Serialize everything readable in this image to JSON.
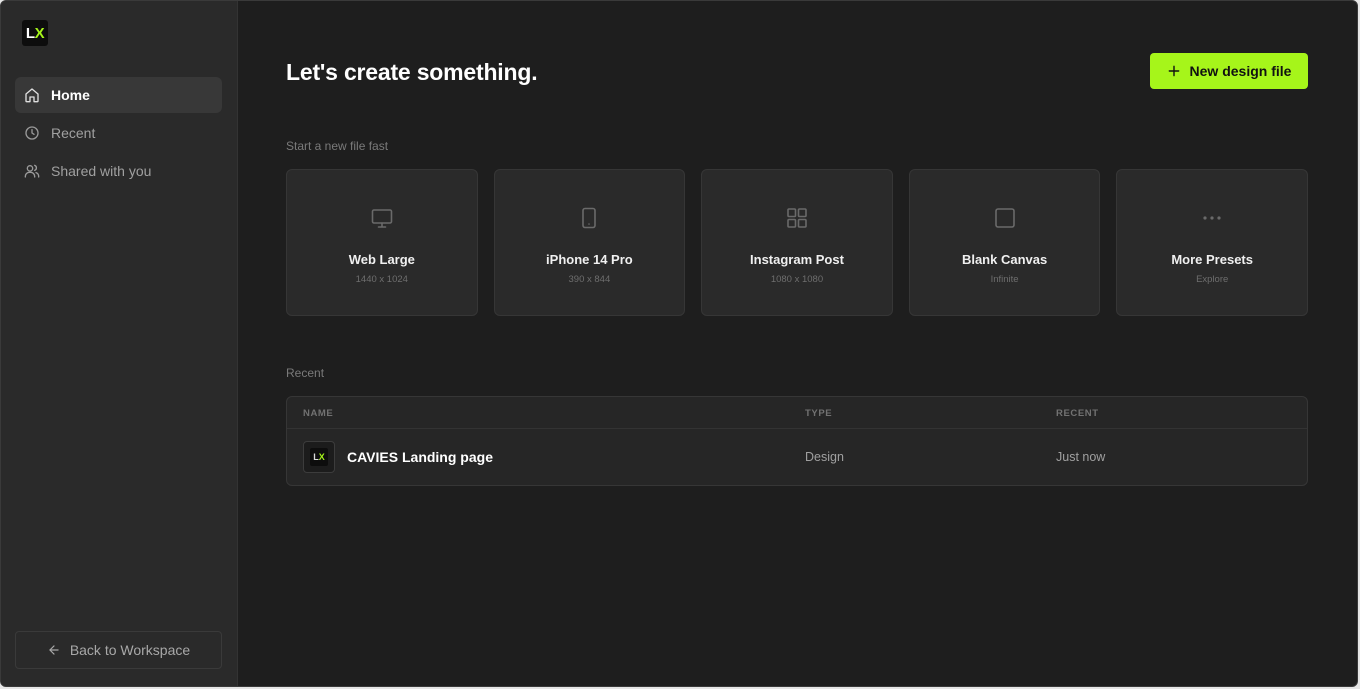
{
  "sidebar": {
    "logo": {
      "l": "L",
      "x": "X"
    },
    "items": [
      {
        "label": "Home",
        "icon": "home-icon",
        "active": true
      },
      {
        "label": "Recent",
        "icon": "clock-icon",
        "active": false
      },
      {
        "label": "Shared with you",
        "icon": "users-icon",
        "active": false
      }
    ],
    "back_label": "Back to Workspace"
  },
  "main": {
    "title": "Let's create something.",
    "new_button_label": "New design file",
    "presets_label": "Start a new file fast",
    "presets": [
      {
        "title": "Web Large",
        "sub": "1440 x 1024",
        "icon": "monitor-icon"
      },
      {
        "title": "iPhone 14 Pro",
        "sub": "390 x 844",
        "icon": "phone-icon"
      },
      {
        "title": "Instagram Post",
        "sub": "1080 x 1080",
        "icon": "grid-icon"
      },
      {
        "title": "Blank Canvas",
        "sub": "Infinite",
        "icon": "square-icon"
      },
      {
        "title": "More Presets",
        "sub": "Explore",
        "icon": "more-icon"
      }
    ],
    "recent_label": "Recent",
    "table": {
      "columns": [
        "NAME",
        "TYPE",
        "RECENT"
      ],
      "rows": [
        {
          "name": "CAVIES Landing page",
          "type": "Design",
          "recent": "Just now",
          "thumb_l": "L",
          "thumb_x": "X"
        }
      ]
    }
  },
  "colors": {
    "accent": "#a6f51a",
    "background": "#1e1e1e",
    "sidebar": "#2a2a2a",
    "card": "#2a2a2a"
  }
}
